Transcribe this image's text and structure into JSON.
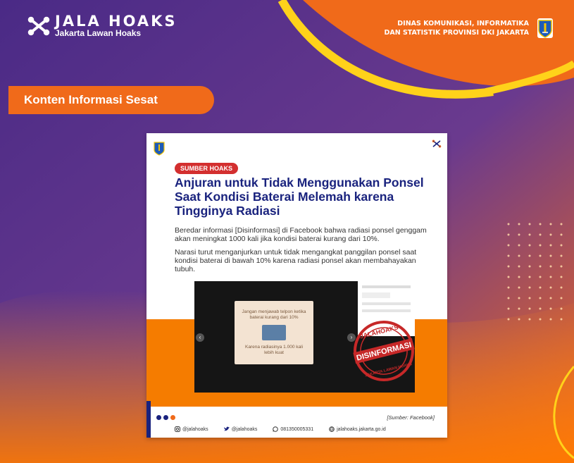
{
  "brand": {
    "title": "JALA HOAKS",
    "subtitle": "Jakarta Lawan Hoaks"
  },
  "agency": {
    "line1": "DINAS KOMUNIKASI, INFORMATIKA",
    "line2": "DAN STATISTIK PROVINSI DKI JAKARTA"
  },
  "category_label": "Konten Informasi Sesat",
  "card": {
    "badge": "SUMBER HOAKS",
    "title": "Anjuran untuk Tidak Menggunakan Ponsel Saat Kondisi Baterai Melemah karena Tingginya Radiasi",
    "paragraph1": "Beredar informasi [Disinformasi] di Facebook bahwa radiasi ponsel genggam akan meningkat 1000 kali jika kondisi baterai kurang dari 10%.",
    "paragraph2": "Narasi turut menganjurkan untuk tidak mengangkat panggilan ponsel saat kondisi baterai di bawah 10% karena radiasi ponsel akan membahayakan tubuh.",
    "evidence_text_top": "Jangan menjawab telpon ketika baterai kurang dari 10%",
    "evidence_text_bottom": "Karena radiasinya 1.000 kali lebih kuat",
    "stamp_top": "JALAHOAKS",
    "stamp_main": "DISINFORMASI",
    "stamp_bottom": "JAKARTA LAWAN HOAKS",
    "source": "[Sumber: Facebook]",
    "footer": {
      "instagram": "@jalahoaks",
      "twitter": "@jalahoaks",
      "whatsapp": "081350005331",
      "website": "jalahoaks.jakarta.go.id"
    }
  },
  "colors": {
    "accent": "#f06a1a",
    "navy": "#1a237e",
    "stamp_red": "#c62828"
  }
}
